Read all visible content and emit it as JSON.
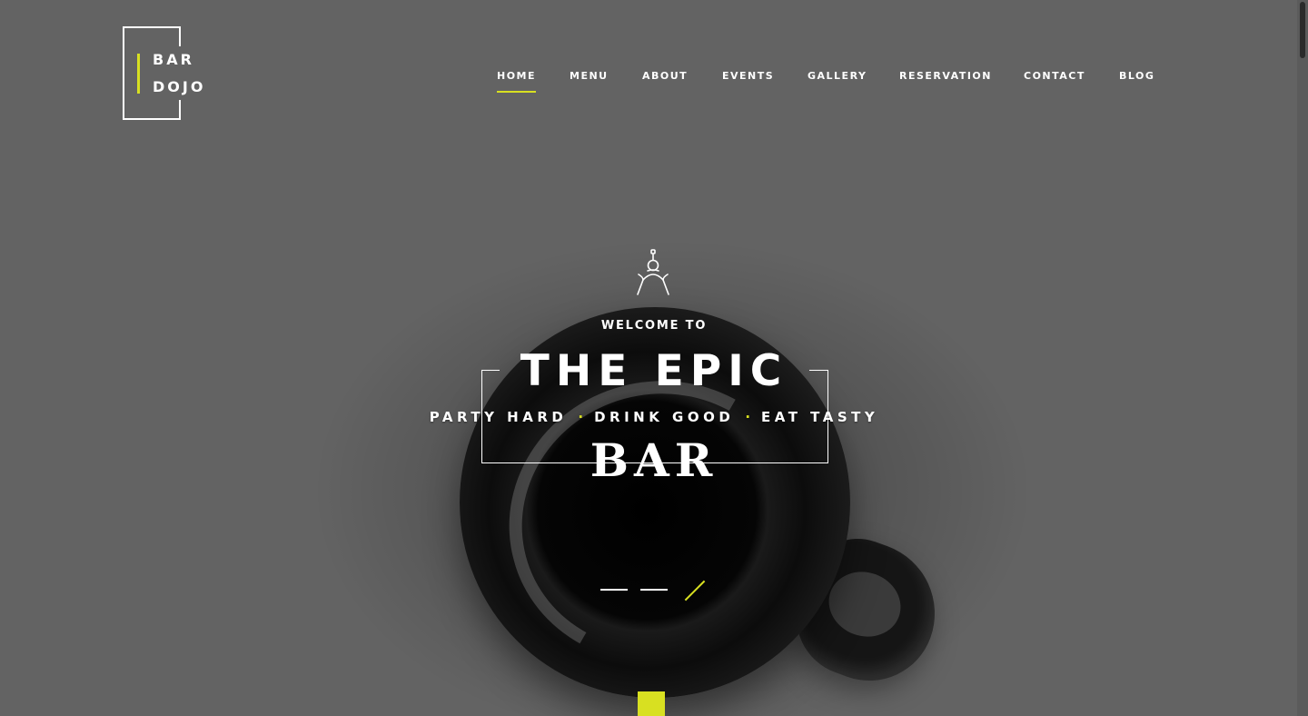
{
  "brand": {
    "logo_line1": "BAR",
    "logo_line2": "DOJO",
    "accent_color": "#d8e021"
  },
  "nav": {
    "items": [
      {
        "label": "HOME",
        "active": true
      },
      {
        "label": "MENU",
        "active": false
      },
      {
        "label": "ABOUT",
        "active": false
      },
      {
        "label": "EVENTS",
        "active": false
      },
      {
        "label": "GALLERY",
        "active": false
      },
      {
        "label": "RESERVATION",
        "active": false
      },
      {
        "label": "CONTACT",
        "active": false
      },
      {
        "label": "BLOG",
        "active": false
      }
    ]
  },
  "hero": {
    "icon": "bartender-icon",
    "welcome": "WELCOME TO",
    "title_line1": "THE EPIC",
    "tagline_parts": [
      "PARTY HARD",
      "DRINK GOOD",
      "EAT TASTY"
    ],
    "title_line2": "BAR"
  },
  "slider": {
    "slide_count": 3,
    "active_index": 2
  }
}
